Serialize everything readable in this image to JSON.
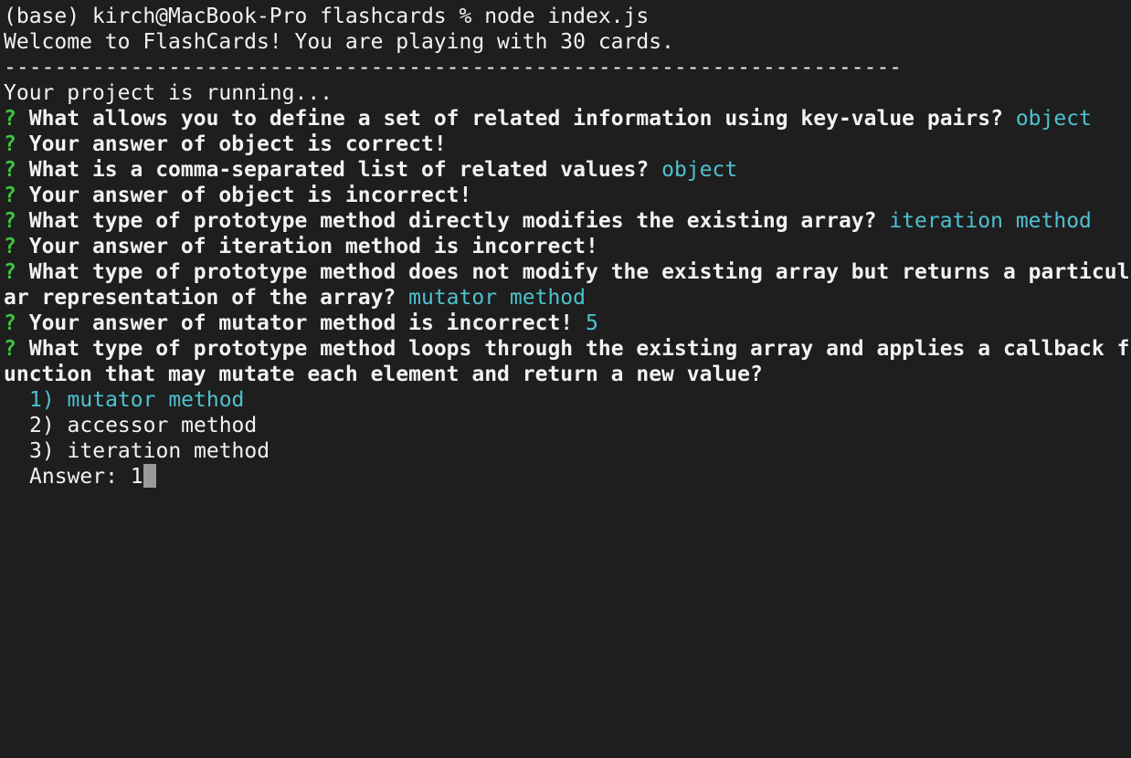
{
  "terminal": {
    "prompt_line": "(base) kirch@MacBook-Pro flashcards % node index.js",
    "welcome": "Welcome to FlashCards! You are playing with 30 cards.",
    "separator": "-----------------------------------------------------------------------",
    "running": "Your project is running...",
    "question_mark": "?",
    "q1": {
      "text": "What allows you to define a set of related information using key-value pairs?",
      "answer": "object"
    },
    "r1": "Your answer of object is correct!",
    "q2": {
      "text": "What is a comma-separated list of related values?",
      "answer": "object"
    },
    "r2": "Your answer of object is incorrect!",
    "q3": {
      "text": "What type of prototype method directly modifies the existing array?",
      "answer": "iteration method"
    },
    "r3": "Your answer of iteration method is incorrect!",
    "q4": {
      "line1": "What type of prototype method does not modify the existing array but returns a particul",
      "line2": "ar representation of the array?",
      "answer": "mutator method"
    },
    "r4": {
      "text": "Your answer of mutator method is incorrect!",
      "extra": "5"
    },
    "q5": {
      "line1": "What type of prototype method loops through the existing array and applies a callback f",
      "line2": "unction that may mutate each element and return a new value?"
    },
    "options": [
      "1) mutator method",
      "2) accessor method",
      "3) iteration method"
    ],
    "answer_label": "Answer: ",
    "answer_value": "1"
  }
}
